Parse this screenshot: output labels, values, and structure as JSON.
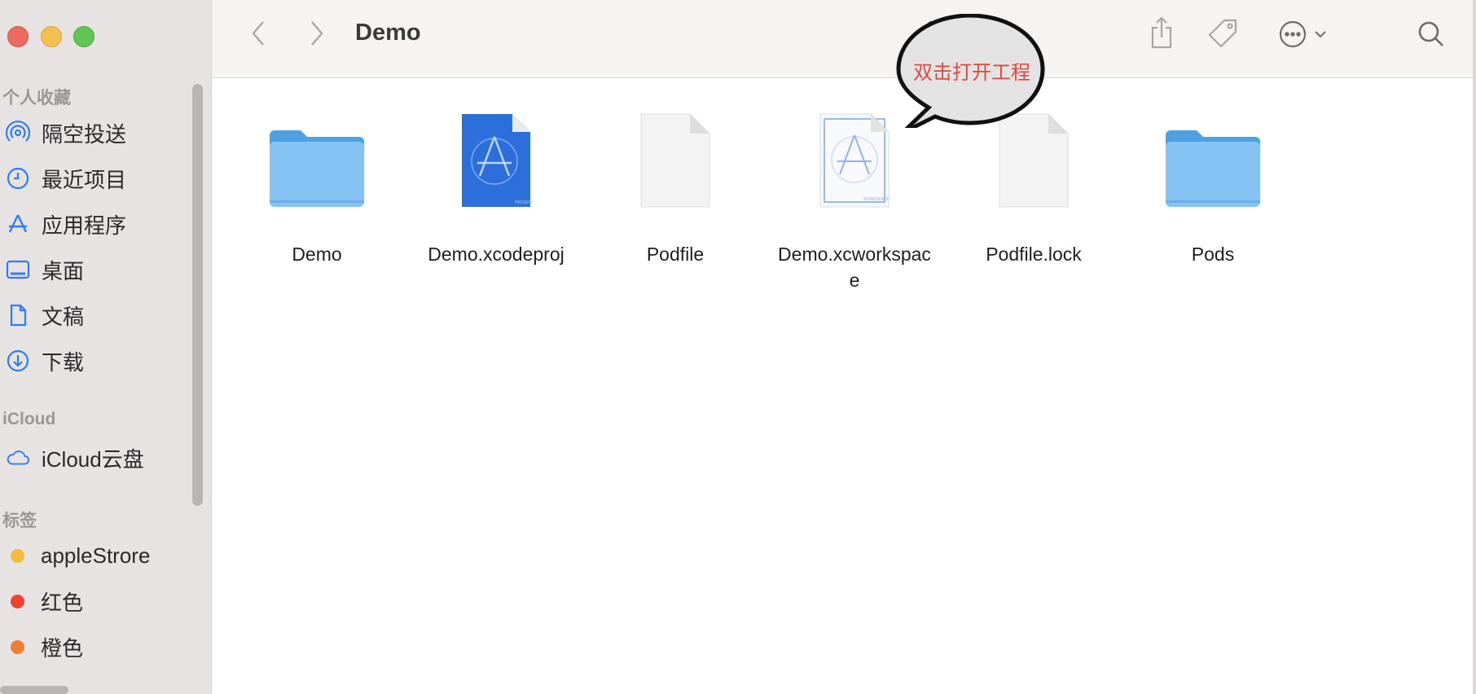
{
  "window": {
    "title": "Demo"
  },
  "sidebar": {
    "favorites_title": "个人收藏",
    "favorites": [
      {
        "label": "隔空投送",
        "icon": "airdrop-icon"
      },
      {
        "label": "最近项目",
        "icon": "clock-icon"
      },
      {
        "label": "应用程序",
        "icon": "applications-icon"
      },
      {
        "label": "桌面",
        "icon": "desktop-icon"
      },
      {
        "label": "文稿",
        "icon": "document-icon"
      },
      {
        "label": "下载",
        "icon": "download-icon"
      }
    ],
    "icloud_title": "iCloud",
    "icloud": [
      {
        "label": "iCloud云盘",
        "icon": "cloud-icon"
      }
    ],
    "tags_title": "标签",
    "tags": [
      {
        "label": "appleStrore",
        "color": "#f2bd3c"
      },
      {
        "label": "红色",
        "color": "#f0432f"
      },
      {
        "label": "橙色",
        "color": "#ee7f32"
      }
    ]
  },
  "toolbar": {
    "icons": [
      "back-icon",
      "forward-icon",
      "view-grid-icon",
      "share-icon",
      "tag-icon",
      "more-icon",
      "search-icon"
    ]
  },
  "files": [
    {
      "name": "Demo",
      "type": "folder"
    },
    {
      "name": "Demo.xcodeproj",
      "type": "xcodeproj"
    },
    {
      "name": "Podfile",
      "type": "document"
    },
    {
      "name": "Demo.xcworkspace",
      "type": "xcworkspace"
    },
    {
      "name": "Podfile.lock",
      "type": "document"
    },
    {
      "name": "Pods",
      "type": "folder"
    }
  ],
  "callout": {
    "text": "双击打开工程",
    "color": "#e0483d"
  }
}
